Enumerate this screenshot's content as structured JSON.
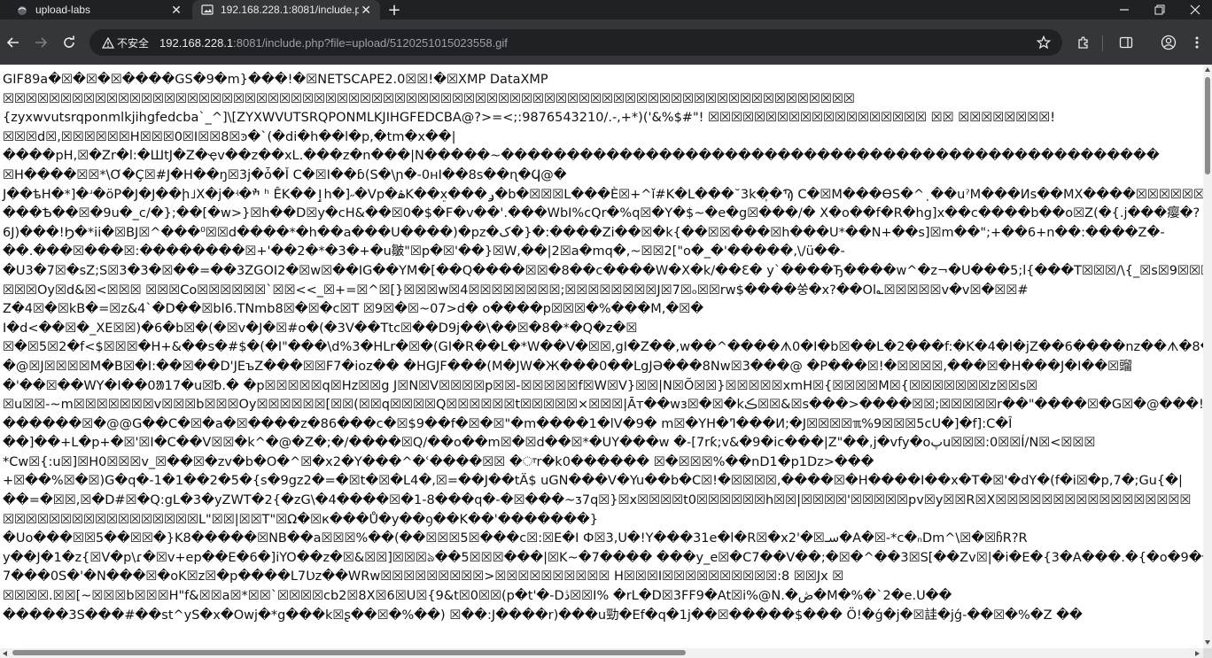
{
  "tabs": [
    {
      "title": "upload-labs",
      "active": false
    },
    {
      "title": "192.168.228.1:8081/include.p",
      "active": true
    }
  ],
  "omnibox": {
    "security_label": "不安全",
    "url_host": "192.168.228.1",
    "url_rest": ":8081/include.php?file=upload/5120251015023558.gif"
  },
  "content": {
    "lines": [
      "GIF89a�☒�☒�☒����GS�9�m}���!�☒NETSCAPE2.0☒☒!�☒XMP DataXMP",
      "☒☒☒☒☒☒☒☒☒☒☒☒☒☒☒☒☒☒☒☒☒☒☒☒☒☒☒☒☒☒☒☒☒☒☒☒☒☒☒☒☒☒☒☒☒☒☒☒☒☒☒☒☒☒☒☒☒☒☒☒☒☒☒☒☒☒☒☒☒☒☒☒☒☒",
      "{zyxwvutsrqponmlkjihgfedcba`_^]\\[ZYXWVUTSRQPONMLKJIHGFEDCBA@?>=<;:9876543210/.-,+*)('&%$#\"! ☒☒☒☒☒☒☒☒☒☒☒☒☒☒☒☒☒☒☒ ☒☒ ☒☒☒☒☒☒☒☒!",
      "☒☒☒d☒,☒☒☒☒☒☒H☒☒☒0☒I☒☒8☒ͽ�`(�di�h��l�p,�tm�x��|",
      "����pH,☒�Zr�l:�ШtJ�Z�ҿv��z��xL.���z�n���|N�����~��������������������������������������������������",
      "☒H����☒☒*\\Ơ�Ç☒#J�H��ŋ☒3j�ȱ�Ǐ C�☒I��ɓ(S�\\ɲ�-0ʜI��8s��ɳ�Ϥ@�",
      "J��ѣH�*]�ʴ�ӧP�J�J��ի˩X�j�ʵ�ׯ ʰ ÊK��ٳh�]˶�Vp�ۿK��ܸx���ݛ�b�☒☒☒L���È☒+^ǐ#K�L���˘3k�̹�Ϡ C�☒M���ӨS�^ͺ��uˀM���Ͷs��MX����☒☒☒☒☒☒☒☒☒☒☒",
      "���Ѣ��☒�9u�_c/�};��[�w>}☒h��D☒y�cH&��☒0�$�F�v��'.���WbI%cQr�%q☒�Y�$~�e�g☒���/� X�o��f�R�hg]x��c����b��o☒Z(�{.j���瘿�?",
      "6J)���!Ϧ�*ii�☒BJ☒^���⁰☒☒d����*�h��a���U����)�pz�ک�}�:����Zi��☒�k{��☒☒���☒h���U*��N+��s]☒m��\";+��6+n��:����Z�-",
      "��.���☒���☒:��������☒+'��2�*�3�+�u皺\"☒p�☒'��}☒W,��|2☒a�mq�,~☒☒2[\"o�_�'�����‚\\/ü��-",
      "�U3�7☒�sZ;S☒3�3�☒��=��3ZGOI2�☒w☒��IG��YM�[��Q����☒☒�8��c����W�X�k/��Ꜫ� y`����Ђ����w^�z¬�U���5;l{���T☒☒☒/\\{_☒s☒9☒☒☒?",
      "☒☒☒Oy☒d&☒<☒☒☒ ☒☒☒Co☒☒☒☒☒☒`☒☒<<_☒+=☒^☒[}☒☒☒w☒4☒☒☒☒☒☒☒☒;☒☒☒☒☒☒☒☒J☒7☒ₒ☒☒rw$����쑹�x?��Ol؎☒☒☒☒☒v�v☒�☒☒#",
      "Z�4☒�☒kB�=☒z&4`�D��☒bl6.TNmb8☒�☒�c☒T ☒9☒�☒~07>d� o����p☒☒☒�%���M,�☒�",
      "I�d<��☒�_XE☒☒)�6�b☒�(�☒v�J�☒#o�(�3V��Ttc☒��D9j��\\��☒�8�*�Q�z�☒",
      "☒�☒5☒2�f<$☒☒☒�H+&��s�#$�(�I\"���\\d%3�HLr�☒�(GI�R��L�*W��V�☒☒,gI�Z��,w��^����ᗑ0�I�b☒��L�2���f:�K�4�I�jZ��6����nz��ᗑ�8�I�r���L�:�",
      "�@☒J☒☒☒☒M�B☒�I:��☒��D'JEъZ���☒☒F7�ioz�� �HGJF���(M�JW�Ж���0��LgJӘ���8Nw☒3���@ �P���☒!�☒☒☒☒,���☒�H���J�I��☒䝀",
      "�'��☒��WY�I��0ᱟ17�u☒␢.� �p☒☒☒☒☒q☒Hz☒☒g J☒N☒V☒☒☒☒p☒☒-☒☒☒☒☒f☒W☒V}☒☒|N☒Õ☒☒}☒☒☒☒☒xmH☒{☒☒☒☒M☒{☒☒☒☒☒☒☒z☒☒s☒",
      "☒u☒☒-~m☒☒☒☒☒☒☒v☒☒☒b☒☒☒Oy☒☒☒☒☒☒[☒☒(☒☒q☒☒☒☒Q☒☒☒☒☒☒t☒☒☒☒☒×☒☒☒|Āт��wз☒�☒�kڪ☒☒&☒s���>����☒☒;☒☒☒☒☒r��\"����☒�G☒�@���!",
      "������☒�@@G��C�☒�a�☒����z�86���c�☒$9��f�☒�☒\"�m����1�lV�9� m☒�YH�ߣ���И;�J☒☒☒☒ℼ%9☒☒☒5cU�]�f]:C�Î",
      "��]��+L�p+�☒'☒I�C��V☒☒�k^�@�Z�;�/����☒Q/��o��m☒�☒d��☒*�UY���w �-[7rƙ;v&�9�ic���|Z\"��,j�vfy�oپu☒☒☒:0☒☒Í/N☒<☒☒☒",
      "*Cw☒{:u☒]☒H0☒☒☒v_☒��☒�zv�b�O�^☒�x2�Y���^�ʿ����☒☒ �ਾr�k0������ ☒�☒☒☒%��nD1�p1Dz>���",
      "+☒��%☒�☒)G�q�-1�1��2�5�{s�9gz2�=�☒t�☒�L4�,☒=��J��tÄ$ uGN���V�Yu��b�C☒!�☒☒☒☒,����☒�H����I��x�T�☒'�dY�(f�i☒�p,7�;Gu{�|",
      "��=�☒☒,☒�D#☒�Q:gL�3�yZWT�2{�zG\\�4����☒�1-8���q�-�☒���~ᴣ7q☒}☒x☒☒☒☒t0☒☒☒☒☒☒h☒☒|☒☒☒☒'☒☒☒☒☒pv☒y☒☒R☒X☒☒☒☒☒☒☒☒☒☒☒☒☒☒☒☒☒",
      "☒☒☒☒☒☒☒☒☒☒☒☒☒☒☒☒☒L\"☒☒|☒☒T\"☒Ω�☒к���Ů�y��ꝯ��K��'�������}",
      "�Uo���☒☒5��☒☒�}K8�����☒NB��a☒☒☒%��(��☒☒☒5☒���c☒:☒E�I Ф☒3,U�!Y���31e�l�R☒�x2'�☒سـ�A�☒-*c�ₙDm^\\☒�☒ჩR?R",
      "y��J�1�z{☒V�p\\ɾ�☒v+ep��E�6�]iYO��z�☒&☒☒]☒☒☒ঌ��5☒☒☒���|☒K~�7���� ���y_e☒�C7��V��;�☒�^��3☒S[��Zv☒|�i�E�{3�A���.�{�o�9��.�)�☒峙",
      "7���0S�'�N���☒�oK☒z☒�p����L7Ʋz��WRw☒☒☒☒☒☒☒☒☒>☒☒☒☒☒☒☒☒☒☒ H☒☒☒I☒☒☒☒☒☒☒☒☒☒:8 ☒☒Jx ☒",
      "☒☒☒☒.☒☒[~☒☒☒b☒☒☒H\"f&☒☒a☒*☒☒`☒☒☒☒cb2☒8X☒6☒U☒{9&t☒0☒☒(p�t'�-Dڎ☒☒I% �rL�D☒3FF9�At☒i%@N.�ڞ�M�%�`2�e.U��",
      "�����3S���#��st^yS�x�Owj�*g���k☒ʂ��☒�%��) ☒��:J����r)���u勁�Ef�q�1j��☒�����$��� Ö!�ǵ�j�☒詿�jǵ-��☒�%�Z ��"
    ]
  },
  "colors": {
    "chrome_dark": "#202124",
    "chrome_toolbar": "#35363a",
    "text_light": "#e8eaed",
    "text_muted": "#9aa0a6",
    "page_bg": "#ffffff"
  },
  "icons": [
    "incognito-like-icon",
    "image-favicon-icon",
    "close-icon",
    "plus-icon",
    "minimize-icon",
    "maximize-icon",
    "window-close-icon",
    "back-arrow-icon",
    "forward-arrow-icon",
    "reload-icon",
    "warning-icon",
    "star-icon",
    "extensions-icon",
    "sidepanel-icon",
    "profile-icon",
    "kebab-menu-icon"
  ]
}
